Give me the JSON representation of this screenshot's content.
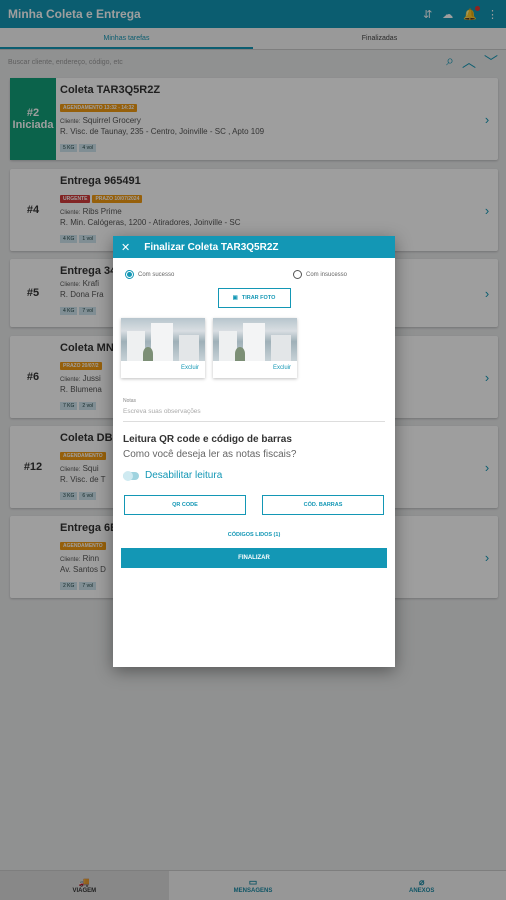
{
  "app": {
    "title": "Minha Coleta e Entrega",
    "notification_badge": "1"
  },
  "tabs": [
    "Minhas tarefas",
    "Finalizadas"
  ],
  "search": {
    "placeholder": "Buscar cliente, endereço, código, etc"
  },
  "cards": [
    {
      "number": "#2",
      "status": "Iniciada",
      "title": "Coleta TAR3Q5R2Z",
      "tags": [
        "AGENDAMENTO 13:32 - 14:32"
      ],
      "client_label": "Cliente:",
      "client": "Squirrel Grocery",
      "address": "R. Visc. de Taunay, 235 - Centro, Joinville - SC , Apto 109",
      "chips": [
        "5 KG",
        "4 vol"
      ]
    },
    {
      "number": "#4",
      "title": "Entrega 965491",
      "tags": [
        "URGENTE",
        "PRAZO 10/07/2024"
      ],
      "client_label": "Cliente:",
      "client": "Ribs Prime",
      "address": "R. Min. Calógeras, 1200 - Atiradores, Joinville - SC",
      "chips": [
        "4 KG",
        "1 vol"
      ]
    },
    {
      "number": "#5",
      "title": "Entrega 34",
      "client_label": "Cliente:",
      "client": "Krafi",
      "address": "R. Dona Fra",
      "chips": [
        "4 KG",
        "7 vol"
      ]
    },
    {
      "number": "#6",
      "title": "Coleta MN",
      "tags": [
        "PRAZO 20/07/2"
      ],
      "client_label": "Cliente:",
      "client": "Jussi",
      "address": "R. Blumena",
      "chips": [
        "7 KG",
        "2 vol"
      ]
    },
    {
      "number": "#12",
      "title": "Coleta DB",
      "tags": [
        "AGENDAMENTO"
      ],
      "client_label": "Cliente:",
      "client": "Squi",
      "address": "R. Visc. de T",
      "chips": [
        "3 KG",
        "6 vol"
      ]
    },
    {
      "number": "",
      "title": "Entrega 6E",
      "tags": [
        "AGENDAMENTO"
      ],
      "client_label": "Cliente:",
      "client": "Rinn",
      "address": "Av. Santos D",
      "chips": [
        "2 KG",
        "7 vol"
      ]
    }
  ],
  "modal": {
    "title": "Finalizar Coleta TAR3Q5R2Z",
    "radio_success": "Com sucesso",
    "radio_failure": "Com insucesso",
    "take_photo": "TIRAR FOTO",
    "photo_delete": "Excluir",
    "obs_label": "Notas",
    "obs_placeholder": "Escreva suas observações",
    "qr_title": "Leitura QR code e código de barras",
    "qr_subtitle": "Como você deseja ler as notas fiscais?",
    "toggle_label": "Desabilitar leitura",
    "qr_button": "QR CODE",
    "barcode_button": "CÓD. BARRAS",
    "codes_read": "CÓDIGOS LIDOS (1)",
    "finish": "FINALIZAR"
  },
  "bottom_nav": [
    "VIAGEM",
    "MENSAGENS",
    "ANEXOS"
  ],
  "colors": {
    "primary": "#1397b5",
    "started": "#13a07a",
    "tag_orange": "#f39c12",
    "tag_red": "#d23b3b"
  }
}
